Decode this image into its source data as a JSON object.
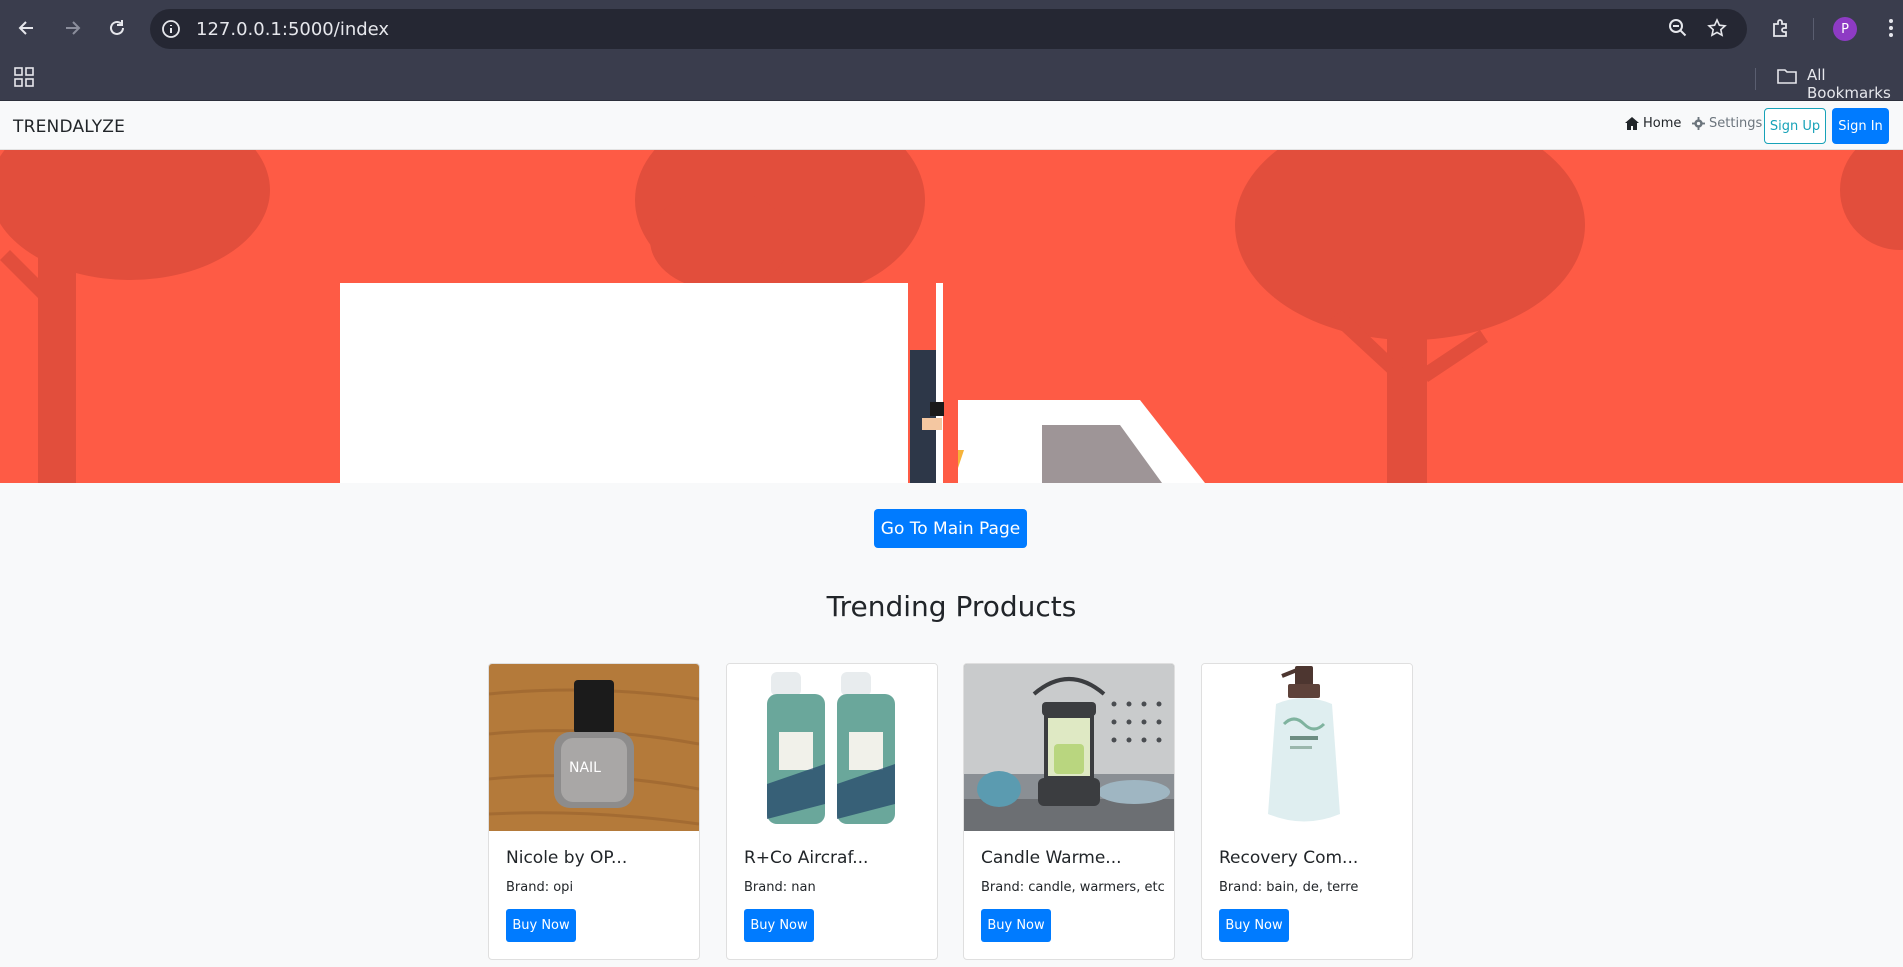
{
  "browser": {
    "url": "127.0.0.1:5000/index",
    "bookmarks_label": "All Bookmarks",
    "profile_initial": "P"
  },
  "navbar": {
    "brand": "TRENDALYZE",
    "home_label": "Home",
    "settings_label": "Settings",
    "signup_label": "Sign Up",
    "signin_label": "Sign In"
  },
  "hero": {
    "cta_label": "Go To Main Page",
    "background_color": "#fe5b45"
  },
  "section": {
    "title": "Trending Products"
  },
  "products": [
    {
      "title": "Nicole by OP...",
      "brand": "Brand: opi",
      "button": "Buy Now"
    },
    {
      "title": "R+Co Aircraf...",
      "brand": "Brand: nan",
      "button": "Buy Now"
    },
    {
      "title": "Candle Warme...",
      "brand": "Brand: candle, warmers, etc",
      "button": "Buy Now"
    },
    {
      "title": "Recovery Com...",
      "brand": "Brand: bain, de, terre",
      "button": "Buy Now"
    }
  ],
  "colors": {
    "primary": "#007bff",
    "info": "#17a2b8",
    "chrome": "#3a3d4d"
  }
}
